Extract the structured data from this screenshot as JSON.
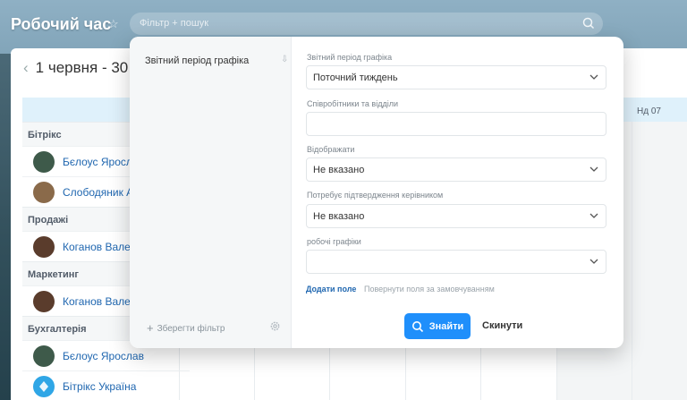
{
  "app": {
    "title": "Робочий час"
  },
  "search": {
    "placeholder": "Фільтр + пошук"
  },
  "calendar": {
    "period": "1 червня - 30",
    "day_column": "Нд 07",
    "groups": [
      {
        "name": "Бітрікс",
        "employees": [
          {
            "name": "Бєлоус Ярослав",
            "avatar_color": "#3e5a4a"
          },
          {
            "name": "Слободяник Ані",
            "avatar_color": "#8a6a4a"
          }
        ]
      },
      {
        "name": "Продажі",
        "employees": [
          {
            "name": "Коганов Валерій",
            "avatar_color": "#5a3c2c"
          }
        ]
      },
      {
        "name": "Маркетинг",
        "employees": [
          {
            "name": "Коганов Валерій",
            "avatar_color": "#5a3c2c"
          }
        ]
      },
      {
        "name": "Бухгалтерія",
        "employees": [
          {
            "name": "Бєлоус Ярослав",
            "avatar_color": "#3e5a4a"
          },
          {
            "name": "Бітрікс Україна",
            "avatar_color": "#2fa6e6"
          }
        ]
      }
    ]
  },
  "filter": {
    "presets": [
      "Звітний період графіка"
    ],
    "save_label": "Зберегти фільтр",
    "fields": [
      {
        "label": "Звітний період графіка",
        "value": "Поточний тиждень",
        "dropdown": true
      },
      {
        "label": "Співробітники та відділи",
        "value": "",
        "dropdown": false
      },
      {
        "label": "Відображати",
        "value": "Не вказано",
        "dropdown": true
      },
      {
        "label": "Потребує підтвердження керівником",
        "value": "Не вказано",
        "dropdown": true
      },
      {
        "label": "робочі графіки",
        "value": "",
        "dropdown": true
      }
    ],
    "add_field": "Додати поле",
    "restore_fields": "Повернути поля за замовчуванням",
    "find_button": "Знайти",
    "reset_button": "Скинути"
  },
  "colors": {
    "accent": "#1f8ffb",
    "link": "#2067b0"
  }
}
